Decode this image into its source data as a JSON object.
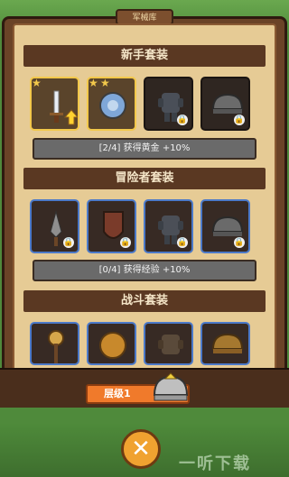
{
  "panel": {
    "tab_label": "军械库"
  },
  "sections": [
    {
      "title": "新手套装",
      "bonus_text": "[2/4] 获得黄金 +10%",
      "items": [
        {
          "name": "sword",
          "stars": 1,
          "style": "gold",
          "has_upgrade": true,
          "locked": false
        },
        {
          "name": "round-shield",
          "stars": 2,
          "style": "gold",
          "has_upgrade": false,
          "locked": false
        },
        {
          "name": "armor",
          "stars": 0,
          "style": "locked",
          "has_upgrade": false,
          "locked": true
        },
        {
          "name": "helmet",
          "stars": 0,
          "style": "locked",
          "has_upgrade": false,
          "locked": true
        }
      ]
    },
    {
      "title": "冒险者套装",
      "bonus_text": "[0/4] 获得经验 +10%",
      "items": [
        {
          "name": "spear-tip",
          "stars": 0,
          "style": "blue",
          "has_upgrade": false,
          "locked": true
        },
        {
          "name": "kite-shield",
          "stars": 0,
          "style": "blue",
          "has_upgrade": false,
          "locked": true
        },
        {
          "name": "armor",
          "stars": 0,
          "style": "blue",
          "has_upgrade": false,
          "locked": true
        },
        {
          "name": "helmet",
          "stars": 0,
          "style": "blue",
          "has_upgrade": false,
          "locked": true
        }
      ]
    },
    {
      "title": "战斗套装",
      "items": [
        {
          "name": "mace",
          "style": "blue"
        },
        {
          "name": "round-shield",
          "style": "blue"
        },
        {
          "name": "armor",
          "style": "blue"
        },
        {
          "name": "helmet",
          "style": "blue"
        }
      ]
    }
  ],
  "footer": {
    "level_label": "层级1"
  },
  "close_button": {
    "icon": "close-icon"
  },
  "watermark": {
    "text": "一听下载"
  }
}
